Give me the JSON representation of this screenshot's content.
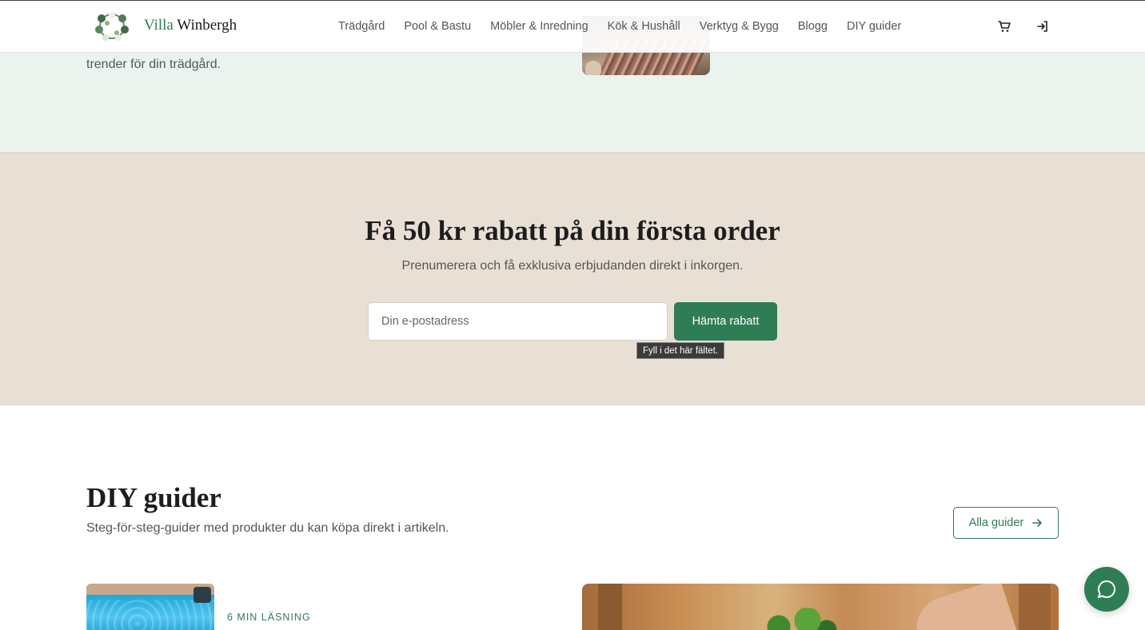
{
  "header": {
    "logo": {
      "text_accent": "Villa",
      "text_rest": "Winbergh"
    },
    "nav": [
      {
        "label": "Trädgård"
      },
      {
        "label": "Pool & Bastu"
      },
      {
        "label": "Möbler & Inredning"
      },
      {
        "label": "Kök & Hushåll"
      },
      {
        "label": "Verktyg & Bygg"
      },
      {
        "label": "Blogg"
      },
      {
        "label": "DIY guider"
      }
    ],
    "icons": {
      "cart": "cart-icon",
      "login": "login-icon"
    }
  },
  "hero": {
    "text": "trender för din trädgård."
  },
  "newsletter": {
    "title": "Få 50 kr rabatt på din första order",
    "subtitle": "Prenumerera och få exklusiva erbjudanden direkt i inkorgen.",
    "email_placeholder": "Din e-postadress",
    "email_value": "",
    "button_label": "Hämta rabatt",
    "validation_tooltip": "Fyll i det här fältet."
  },
  "diy": {
    "title": "DIY guider",
    "subtitle": "Steg-för-steg-guider med produkter du kan köpa direkt i artikeln.",
    "all_button_label": "Alla guider",
    "cards": [
      {
        "meta": "6 MIN LÄSNING"
      }
    ]
  },
  "chat": {
    "icon": "chat-icon"
  },
  "colors": {
    "brand_green": "#2f7d55",
    "hero_bg": "#ebf3ef",
    "newsletter_bg": "#e8e0d5"
  }
}
